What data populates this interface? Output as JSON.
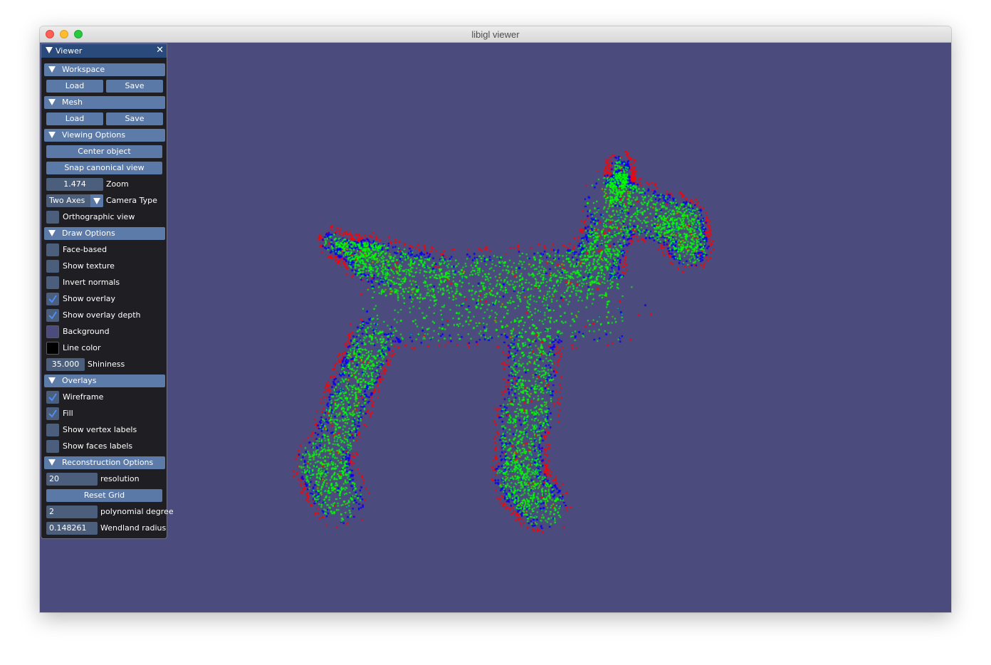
{
  "window": {
    "title": "libigl viewer"
  },
  "viewport": {
    "background_color": "#4c4b7e",
    "model": "dog point cloud",
    "point_colors": [
      "#ff0000",
      "#0000ff",
      "#00ff00"
    ]
  },
  "panel": {
    "title": "Viewer",
    "sections": {
      "workspace": {
        "label": "Workspace",
        "load": "Load",
        "save": "Save"
      },
      "mesh": {
        "label": "Mesh",
        "load": "Load",
        "save": "Save"
      },
      "viewing": {
        "label": "Viewing Options",
        "center": "Center object",
        "snap": "Snap canonical view",
        "zoom_value": "1.474",
        "zoom_label": "Zoom",
        "camera_value": "Two Axes",
        "camera_label": "Camera Type",
        "ortho_label": "Orthographic view",
        "ortho_checked": false
      },
      "draw": {
        "label": "Draw Options",
        "items": [
          {
            "label": "Face-based",
            "checked": false
          },
          {
            "label": "Show texture",
            "checked": false
          },
          {
            "label": "Invert normals",
            "checked": false
          },
          {
            "label": "Show overlay",
            "checked": true
          },
          {
            "label": "Show overlay depth",
            "checked": true
          }
        ],
        "background_label": "Background",
        "background_color": "#4c4b7e",
        "line_color_label": "Line color",
        "line_color": "#000000",
        "shininess_value": "35.000",
        "shininess_label": "Shininess"
      },
      "overlays": {
        "label": "Overlays",
        "items": [
          {
            "label": "Wireframe",
            "checked": true
          },
          {
            "label": "Fill",
            "checked": true
          },
          {
            "label": "Show vertex labels",
            "checked": false
          },
          {
            "label": "Show faces labels",
            "checked": false
          }
        ]
      },
      "reconstruction": {
        "label": "Reconstruction Options",
        "resolution_value": "20",
        "resolution_label": "resolution",
        "reset_grid": "Reset Grid",
        "poly_value": "2",
        "poly_label": "polynomial degree",
        "wendland_value": "0.148261",
        "wendland_label": "Wendland radius"
      }
    }
  }
}
